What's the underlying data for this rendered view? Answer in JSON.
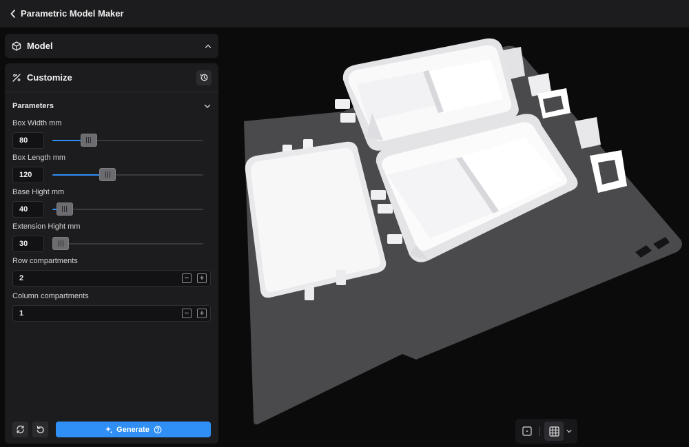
{
  "app": {
    "title": "Parametric Model Maker"
  },
  "model_panel": {
    "title": "Model"
  },
  "customize_panel": {
    "title": "Customize",
    "section_title": "Parameters",
    "sliders": [
      {
        "label": "Box Width mm",
        "value": "80",
        "fill_fraction": 0.21
      },
      {
        "label": "Box Length mm",
        "value": "120",
        "fill_fraction": 0.35
      },
      {
        "label": "Base Hight mm",
        "value": "40",
        "fill_fraction": 0.03
      },
      {
        "label": "Extension Hight mm",
        "value": "30",
        "fill_fraction": 0.0
      }
    ],
    "steppers": [
      {
        "label": "Row compartments",
        "value": "2",
        "minus": "−",
        "plus": "+"
      },
      {
        "label": "Column compartments",
        "value": "1",
        "minus": "−",
        "plus": "+"
      }
    ],
    "generate_label": "Generate"
  },
  "colors": {
    "accent": "#2f8ff5",
    "panel": "#1c1c1e",
    "background": "#0b0b0c",
    "model": "#f4f4f6",
    "build_plate": "#4a4a4d"
  },
  "icons": [
    "chevron-left-icon",
    "cube-icon",
    "chevron-up-icon",
    "wand-icon",
    "history-icon",
    "chevron-down-icon",
    "sync-icon",
    "undo-icon",
    "sparkle-icon",
    "help-icon",
    "single-view-icon",
    "grid-icon"
  ]
}
